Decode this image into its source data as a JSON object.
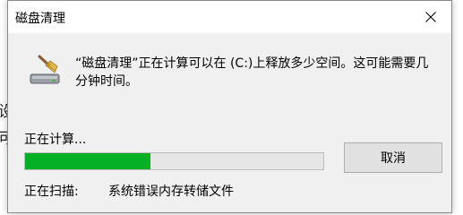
{
  "window": {
    "title": "磁盘清理",
    "close_icon": "close-icon",
    "app_icon": "disk-cleanup-icon"
  },
  "message": "“磁盘清理”正在计算可以在 (C:)上释放多少空间。这可能需要几分钟时间。",
  "progress": {
    "label": "正在计算...",
    "value_percent": 42,
    "fill_color": "#06b025"
  },
  "cancel_label": "取消",
  "scan": {
    "label": "正在扫描:",
    "item": "系统错误内存转储文件"
  },
  "background": {
    "fragment_1": "设",
    "fragment_2": "可"
  }
}
